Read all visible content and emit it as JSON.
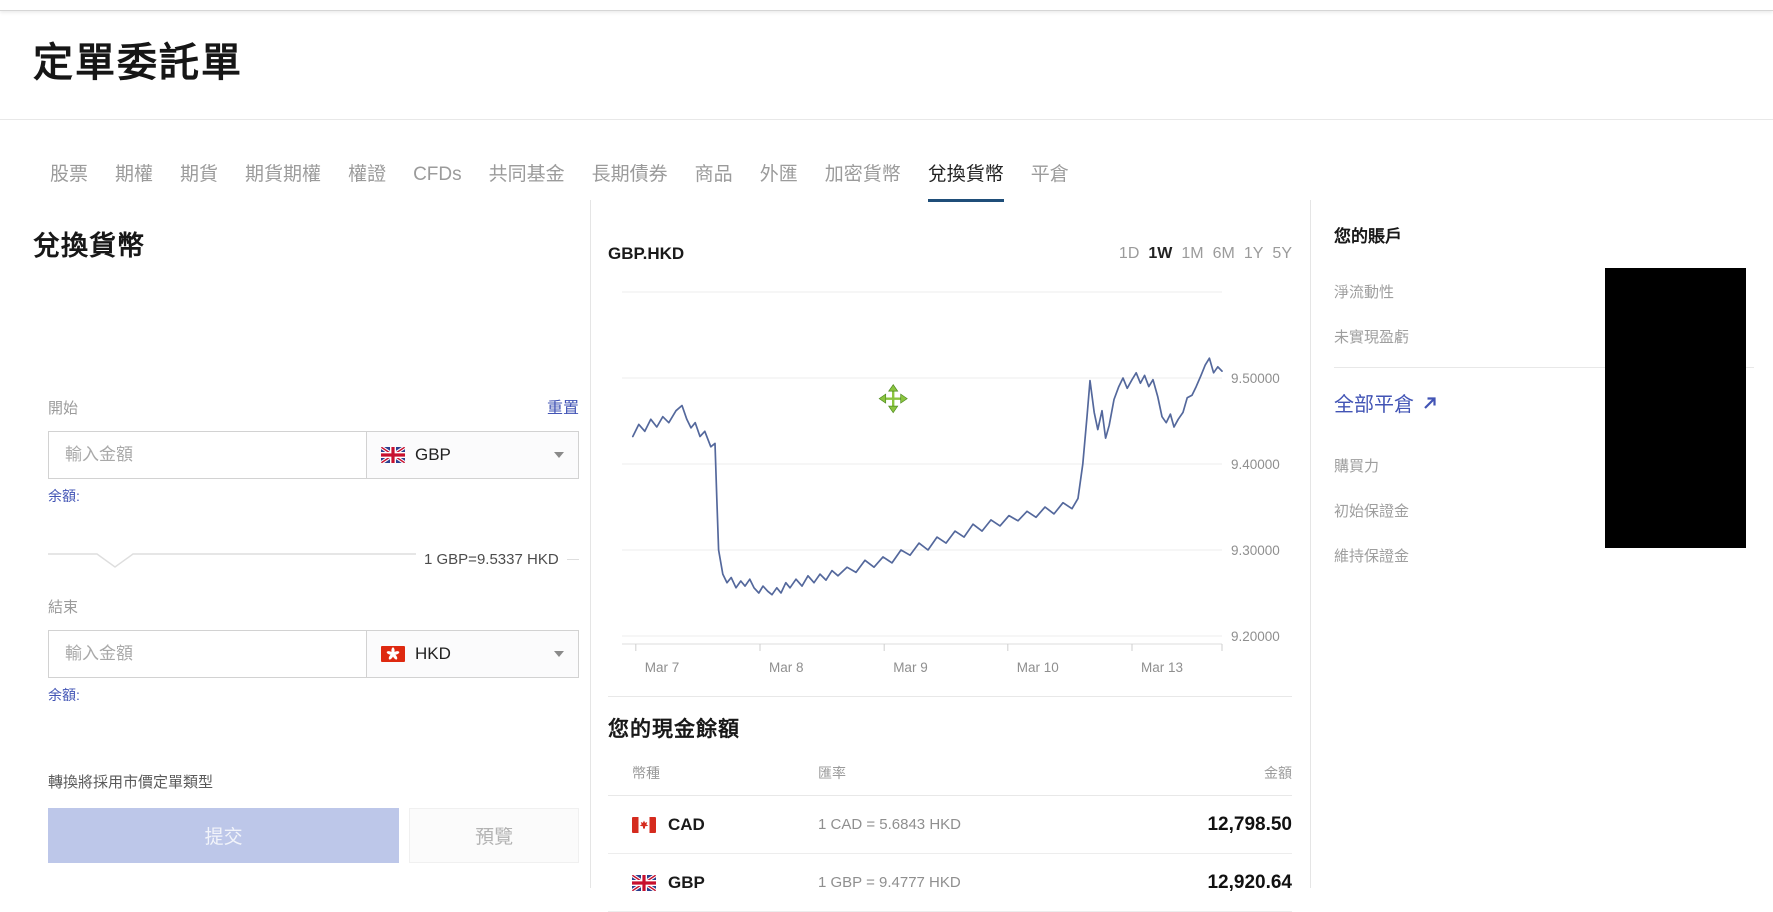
{
  "page": {
    "title": "定單委託單"
  },
  "tabs": {
    "items": [
      {
        "label": "股票"
      },
      {
        "label": "期權"
      },
      {
        "label": "期貨"
      },
      {
        "label": "期貨期權"
      },
      {
        "label": "權證"
      },
      {
        "label": "CFDs"
      },
      {
        "label": "共同基金"
      },
      {
        "label": "長期債券"
      },
      {
        "label": "商品"
      },
      {
        "label": "外匯"
      },
      {
        "label": "加密貨幣"
      },
      {
        "label": "兌換貨幣"
      },
      {
        "label": "平倉"
      }
    ]
  },
  "converter": {
    "heading": "兌換貨幣",
    "reset_label": "重置",
    "from": {
      "label": "開始",
      "placeholder": "輸入金額",
      "currency": "GBP",
      "balance_label": "余額:"
    },
    "rate_text": "1 GBP=9.5337 HKD",
    "to": {
      "label": "結束",
      "placeholder": "輸入金額",
      "currency": "HKD",
      "balance_label": "余額:"
    },
    "note": "轉換將採用市價定單類型",
    "submit_label": "提交",
    "preview_label": "預覽"
  },
  "chart_data": {
    "type": "line",
    "symbol": "GBP.HKD",
    "range_options": [
      "1D",
      "1W",
      "1M",
      "6M",
      "1Y",
      "5Y"
    ],
    "active_range": "1W",
    "x_tick_labels": [
      "Mar 7",
      "Mar 8",
      "Mar 9",
      "Mar 10",
      "Mar 13"
    ],
    "x_tick_fracs": [
      0.023,
      0.23,
      0.437,
      0.643,
      0.85
    ],
    "y_ticks": [
      "9.50000",
      "9.40000",
      "9.30000",
      "9.20000"
    ],
    "y_tick_values": [
      9.5,
      9.4,
      9.3,
      9.2
    ],
    "ylim": [
      9.19,
      9.6
    ],
    "grid": true,
    "line_color": "#54689c",
    "cursor": {
      "x_frac": 0.452,
      "price": 9.476,
      "color": "#8bc53f"
    },
    "series": [
      {
        "name": "GBP.HKD",
        "points": [
          [
            0.018,
            9.432
          ],
          [
            0.028,
            9.446
          ],
          [
            0.038,
            9.438
          ],
          [
            0.048,
            9.452
          ],
          [
            0.058,
            9.443
          ],
          [
            0.068,
            9.455
          ],
          [
            0.078,
            9.448
          ],
          [
            0.09,
            9.462
          ],
          [
            0.1,
            9.468
          ],
          [
            0.108,
            9.452
          ],
          [
            0.115,
            9.442
          ],
          [
            0.122,
            9.448
          ],
          [
            0.13,
            9.432
          ],
          [
            0.138,
            9.438
          ],
          [
            0.148,
            9.42
          ],
          [
            0.155,
            9.424
          ],
          [
            0.158,
            9.36
          ],
          [
            0.161,
            9.3
          ],
          [
            0.168,
            9.272
          ],
          [
            0.175,
            9.262
          ],
          [
            0.182,
            9.268
          ],
          [
            0.19,
            9.256
          ],
          [
            0.198,
            9.264
          ],
          [
            0.205,
            9.258
          ],
          [
            0.213,
            9.266
          ],
          [
            0.22,
            9.256
          ],
          [
            0.228,
            9.25
          ],
          [
            0.235,
            9.258
          ],
          [
            0.243,
            9.252
          ],
          [
            0.25,
            9.248
          ],
          [
            0.258,
            9.256
          ],
          [
            0.265,
            9.25
          ],
          [
            0.273,
            9.262
          ],
          [
            0.28,
            9.256
          ],
          [
            0.29,
            9.266
          ],
          [
            0.3,
            9.258
          ],
          [
            0.31,
            9.27
          ],
          [
            0.32,
            9.262
          ],
          [
            0.33,
            9.272
          ],
          [
            0.34,
            9.265
          ],
          [
            0.35,
            9.276
          ],
          [
            0.36,
            9.27
          ],
          [
            0.375,
            9.28
          ],
          [
            0.39,
            9.274
          ],
          [
            0.405,
            9.288
          ],
          [
            0.42,
            9.28
          ],
          [
            0.435,
            9.292
          ],
          [
            0.45,
            9.285
          ],
          [
            0.465,
            9.3
          ],
          [
            0.48,
            9.294
          ],
          [
            0.495,
            9.308
          ],
          [
            0.51,
            9.3
          ],
          [
            0.525,
            9.315
          ],
          [
            0.54,
            9.308
          ],
          [
            0.555,
            9.322
          ],
          [
            0.57,
            9.315
          ],
          [
            0.585,
            9.33
          ],
          [
            0.6,
            9.322
          ],
          [
            0.615,
            9.335
          ],
          [
            0.63,
            9.328
          ],
          [
            0.645,
            9.34
          ],
          [
            0.66,
            9.334
          ],
          [
            0.675,
            9.345
          ],
          [
            0.69,
            9.338
          ],
          [
            0.705,
            9.35
          ],
          [
            0.72,
            9.342
          ],
          [
            0.735,
            9.355
          ],
          [
            0.75,
            9.348
          ],
          [
            0.76,
            9.36
          ],
          [
            0.768,
            9.4
          ],
          [
            0.775,
            9.455
          ],
          [
            0.78,
            9.497
          ],
          [
            0.787,
            9.46
          ],
          [
            0.793,
            9.44
          ],
          [
            0.8,
            9.462
          ],
          [
            0.806,
            9.43
          ],
          [
            0.812,
            9.445
          ],
          [
            0.82,
            9.475
          ],
          [
            0.828,
            9.49
          ],
          [
            0.835,
            9.5
          ],
          [
            0.842,
            9.488
          ],
          [
            0.85,
            9.498
          ],
          [
            0.857,
            9.506
          ],
          [
            0.864,
            9.494
          ],
          [
            0.871,
            9.503
          ],
          [
            0.878,
            9.49
          ],
          [
            0.885,
            9.498
          ],
          [
            0.893,
            9.478
          ],
          [
            0.9,
            9.455
          ],
          [
            0.907,
            9.448
          ],
          [
            0.914,
            9.458
          ],
          [
            0.92,
            9.443
          ],
          [
            0.927,
            9.452
          ],
          [
            0.935,
            9.46
          ],
          [
            0.942,
            9.477
          ],
          [
            0.95,
            9.48
          ],
          [
            0.957,
            9.49
          ],
          [
            0.965,
            9.503
          ],
          [
            0.972,
            9.515
          ],
          [
            0.979,
            9.523
          ],
          [
            0.986,
            9.506
          ],
          [
            0.993,
            9.513
          ],
          [
            1.0,
            9.508
          ]
        ]
      }
    ]
  },
  "cash": {
    "heading": "您的現金餘額",
    "columns": [
      "幣種",
      "匯率",
      "金額"
    ],
    "rows": [
      {
        "code": "CAD",
        "rate": "1 CAD  =  5.6843 HKD",
        "amount": "12,798.50"
      },
      {
        "code": "GBP",
        "rate": "1 GBP  =  9.4777 HKD",
        "amount": "12,920.64"
      }
    ]
  },
  "account": {
    "heading": "您的賬戶",
    "rows_top": [
      {
        "label": "淨流動性"
      },
      {
        "label": "未實現盈虧"
      }
    ],
    "close_all_label": "全部平倉",
    "rows_bottom": [
      {
        "label": "購買力"
      },
      {
        "label": "初始保證金"
      },
      {
        "label": "維持保證金"
      }
    ]
  },
  "colors": {
    "link_blue": "#4254b5",
    "active_tab_underline": "#1f4e79",
    "chart_line": "#54689c",
    "cursor_green": "#8bc53f",
    "submit_bg": "#bdc7e9"
  }
}
